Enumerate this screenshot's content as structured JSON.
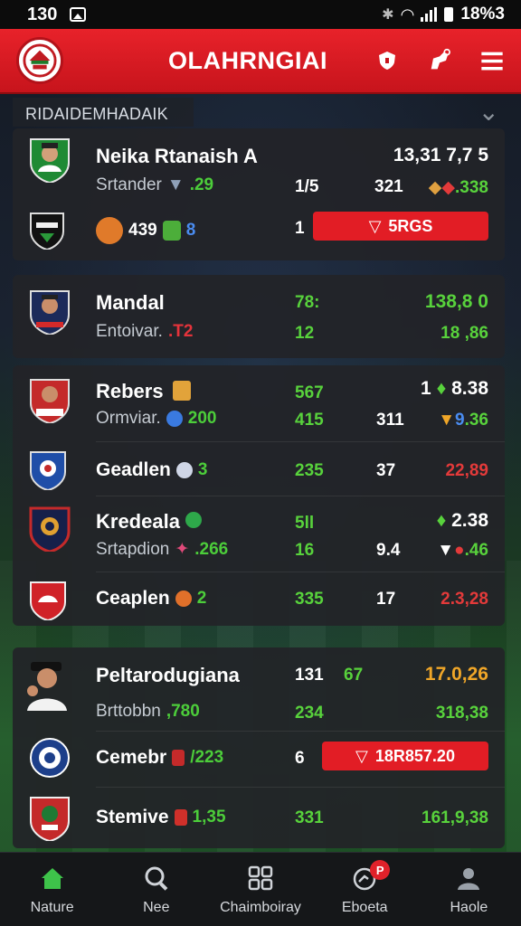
{
  "status": {
    "time": "130",
    "battery": "18%3"
  },
  "header": {
    "title": "OLAHRNGIAI"
  },
  "section": {
    "label": "RIDAIDEMHADAIK"
  },
  "cards": [
    {
      "rows": [
        {
          "name": "Neika Rtanaish A",
          "sub_label": "Srtander",
          "sub_stat": ".29",
          "col1": "1/5",
          "col2": "321",
          "top_right": "13,31 7,7 5",
          "right_stat": ".338"
        },
        {
          "name": "",
          "sub_label": "",
          "sub_stat": "439",
          "sub_stat2": "8",
          "col1": "1",
          "pill": "5RGS"
        }
      ]
    },
    {
      "rows": [
        {
          "name": "Mandal",
          "sub_label": "Entoivar.",
          "sub_stat": ".T2",
          "col_top": "78:",
          "col1": "12",
          "top_right": "138,8 0",
          "right_stat": "18 ,86"
        }
      ]
    },
    {
      "rows": [
        {
          "name": "Rebers",
          "sub_label": "Ormviar.",
          "sub_stat": "200",
          "col_top": "567",
          "col1": "415",
          "col2": "311",
          "top_right": "1",
          "top_right2": "8.38",
          "right_stat": ".36"
        },
        {
          "name": "Geadlen",
          "sub_stat": "3",
          "col1": "235",
          "col2": "37",
          "right_stat": "22,89"
        },
        {
          "name": "Kredeala",
          "sub_label": "Srtapdion",
          "sub_stat": ".266",
          "col_top": "5ll",
          "col1": "16",
          "col2": "9.4",
          "top_right": "2.38",
          "right_stat": ".46"
        },
        {
          "name": "Ceaplen",
          "sub_stat": "2",
          "col1": "335",
          "col2": "17",
          "right_stat": "2.3,28"
        }
      ]
    },
    {
      "rows": [
        {
          "name": "Peltarodugiana",
          "sub_label": "Brttobbn",
          "sub_stat": ",780",
          "col_top": "131",
          "col_top2": "67",
          "col1": "234",
          "top_right": "17.0,26",
          "right_stat": "318,38"
        },
        {
          "name": "Cemebr",
          "sub_stat": "/223",
          "col1": "6",
          "pill": "18R857.20"
        },
        {
          "name": "Stemive",
          "sub_stat": "1,35",
          "col1": "331",
          "right_stat": "161,9,38"
        }
      ]
    }
  ],
  "nav": {
    "items": [
      {
        "label": "Nature",
        "icon": "home-icon",
        "active": true
      },
      {
        "label": "Nee",
        "icon": "search-icon"
      },
      {
        "label": "Chaimboiray",
        "icon": "grid-icon"
      },
      {
        "label": "Eboeta",
        "icon": "activity-icon",
        "badge": "P"
      },
      {
        "label": "Haole",
        "icon": "profile-icon"
      }
    ]
  },
  "colors": {
    "accent": "#e21d25",
    "positive": "#58d23c",
    "warning": "#f0a628"
  }
}
